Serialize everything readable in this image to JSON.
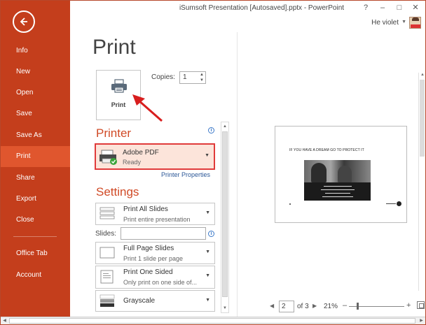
{
  "window": {
    "title": "iSumsoft Presentation [Autosaved].pptx - PowerPoint",
    "help": "?",
    "minimize": "–",
    "restore": "□",
    "close": "✕",
    "user_name": "He violet",
    "user_caret": "▼"
  },
  "sidebar": {
    "items": [
      {
        "label": "Info"
      },
      {
        "label": "New"
      },
      {
        "label": "Open"
      },
      {
        "label": "Save"
      },
      {
        "label": "Save As"
      },
      {
        "label": "Print"
      },
      {
        "label": "Share"
      },
      {
        "label": "Export"
      },
      {
        "label": "Close"
      },
      {
        "label": "Office Tab"
      },
      {
        "label": "Account"
      }
    ],
    "active": "Print"
  },
  "page": {
    "title": "Print"
  },
  "print": {
    "button_label": "Print",
    "copies_label": "Copies:",
    "copies_value": "1"
  },
  "printer": {
    "heading": "Printer",
    "name": "Adobe PDF",
    "status": "Ready",
    "properties_link": "Printer Properties"
  },
  "settings": {
    "heading": "Settings",
    "slides_label": "Slides:",
    "items": [
      {
        "title": "Print All Slides",
        "subtitle": "Print entire presentation"
      },
      {
        "title": "Full Page Slides",
        "subtitle": "Print 1 slide per page"
      },
      {
        "title": "Print One Sided",
        "subtitle": "Only print on one side of..."
      },
      {
        "title": "Grayscale",
        "subtitle": ""
      }
    ]
  },
  "preview": {
    "slide_heading": "IF YOU HAVE A DREAM GO TO PROTECT IT",
    "current_page": "2",
    "of_total": "of 3",
    "zoom": "21%"
  },
  "colors": {
    "sidebar": "#c43e1c",
    "active_nav": "#e0562e",
    "accent_heading": "#d04a26",
    "highlight_border": "#e03a3a",
    "link": "#2b5797"
  }
}
